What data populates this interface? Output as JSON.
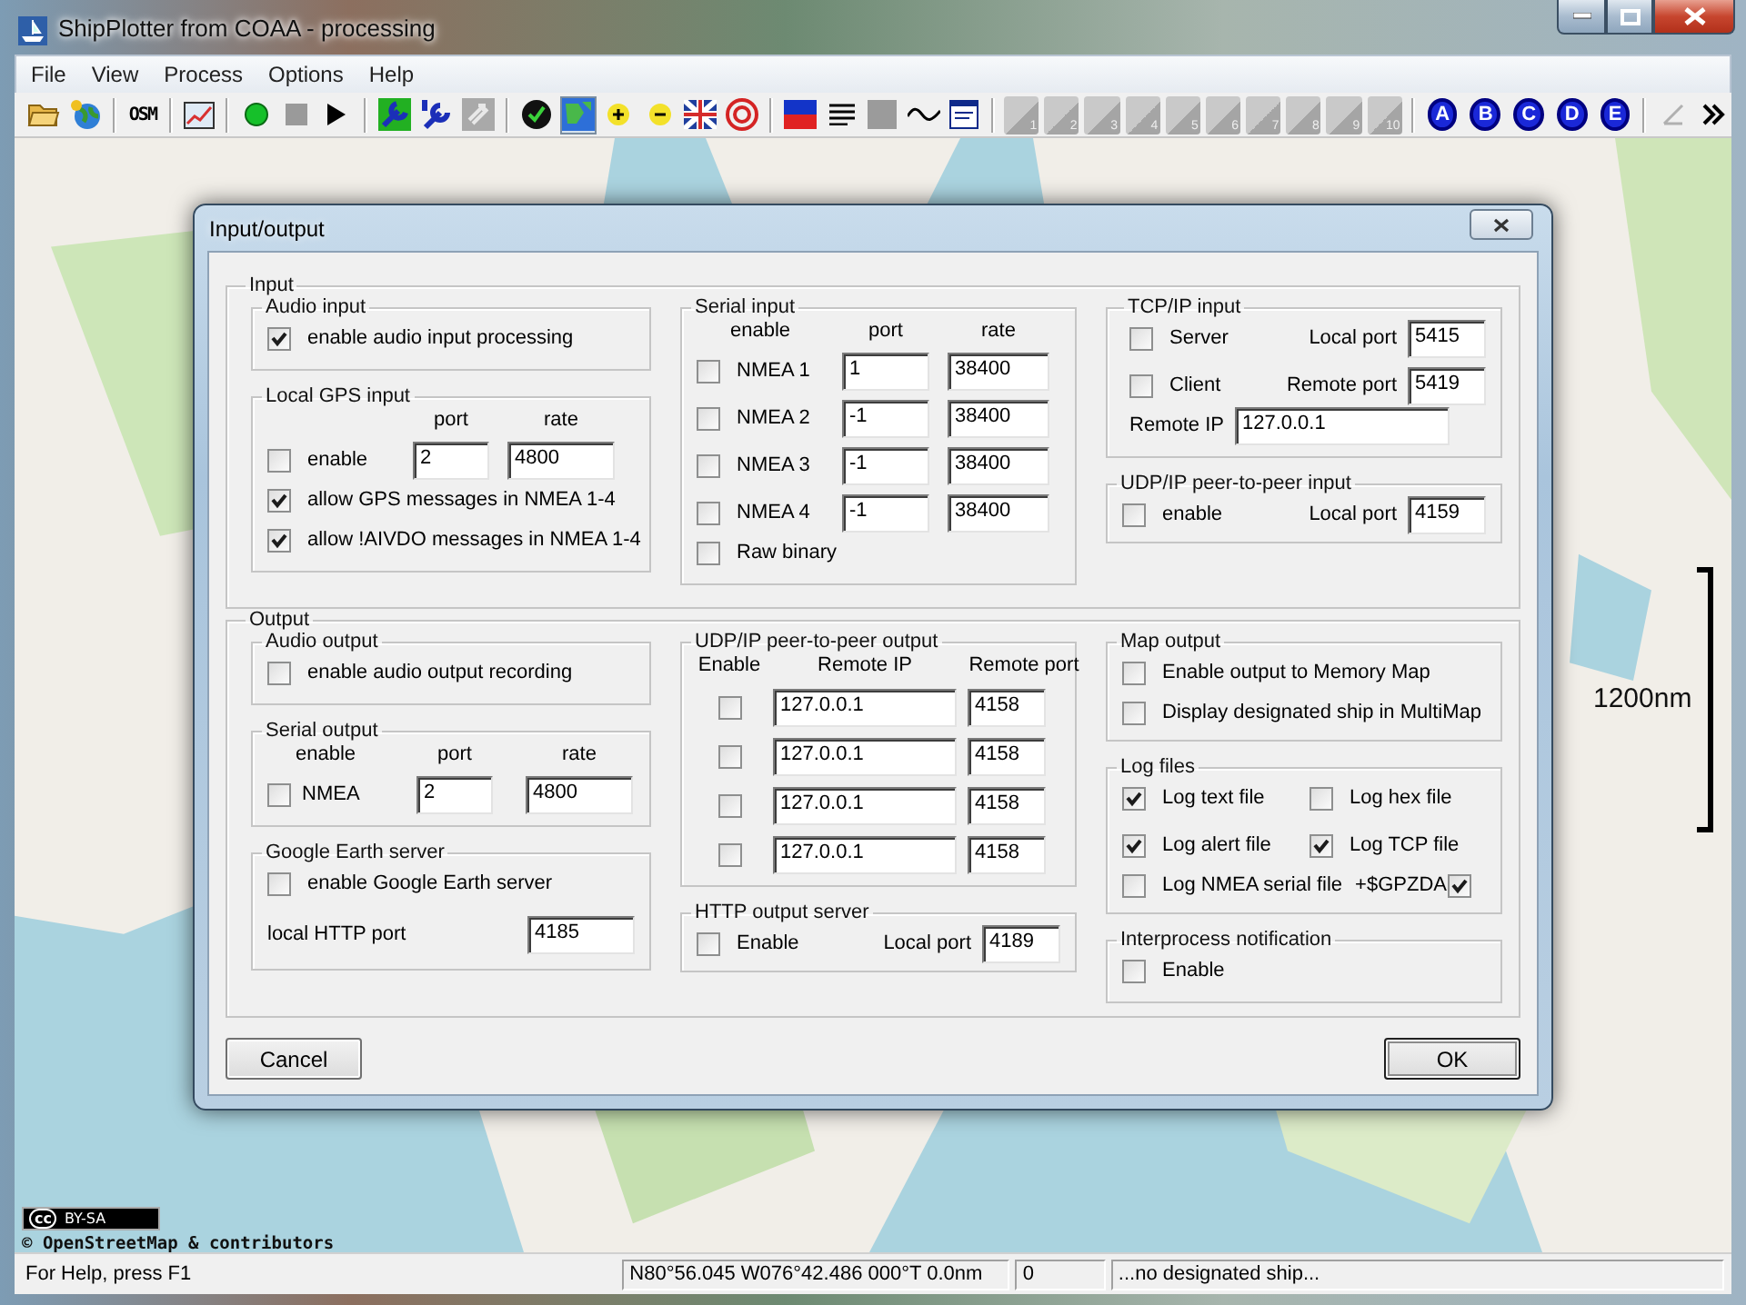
{
  "window": {
    "title": "ShipPlotter from COAA - processing"
  },
  "menu": [
    "File",
    "View",
    "Process",
    "Options",
    "Help"
  ],
  "toolbar": {
    "osm": "OSM",
    "map_view": {
      "selected": true
    },
    "slots": [
      "1",
      "2",
      "3",
      "4",
      "5",
      "6",
      "7",
      "8",
      "9",
      "10"
    ],
    "filters": [
      "A",
      "B",
      "C",
      "D",
      "E"
    ]
  },
  "map": {
    "scale": "1200nm",
    "license": "BY-SA",
    "cc": "cc",
    "attribution": "© OpenStreetMap & contributors"
  },
  "dialog": {
    "title": "Input/output",
    "input": {
      "label": "Input",
      "audio": {
        "label": "Audio input",
        "enable": {
          "label": "enable audio input processing",
          "checked": true
        }
      },
      "gps": {
        "label": "Local GPS input",
        "headings": [
          "port",
          "rate"
        ],
        "enable": {
          "label": "enable",
          "checked": false
        },
        "port": "2",
        "rate": "4800",
        "options": [
          {
            "label": "allow GPS messages in NMEA 1-4",
            "checked": true
          },
          {
            "label": "allow !AIVDO messages in NMEA 1-4",
            "checked": true
          }
        ]
      },
      "serial": {
        "label": "Serial input",
        "headings": [
          "enable",
          "port",
          "rate"
        ],
        "rows": [
          {
            "label": "NMEA 1",
            "checked": false,
            "port": "1",
            "rate": "38400"
          },
          {
            "label": "NMEA 2",
            "checked": false,
            "port": "-1",
            "rate": "38400"
          },
          {
            "label": "NMEA 3",
            "checked": false,
            "port": "-1",
            "rate": "38400"
          },
          {
            "label": "NMEA 4",
            "checked": false,
            "port": "-1",
            "rate": "38400"
          }
        ],
        "raw": {
          "label": "Raw binary",
          "checked": false
        }
      },
      "tcp": {
        "label": "TCP/IP input",
        "server": {
          "label": "Server",
          "checked": false
        },
        "local_port_label": "Local port",
        "local_port": "5415",
        "client": {
          "label": "Client",
          "checked": false
        },
        "remote_port_label": "Remote port",
        "remote_port": "5419",
        "remote_ip_label": "Remote IP",
        "remote_ip": "127.0.0.1"
      },
      "udp": {
        "label": "UDP/IP peer-to-peer input",
        "enable": {
          "label": "enable",
          "checked": false
        },
        "local_port_label": "Local port",
        "local_port": "4159"
      }
    },
    "output": {
      "label": "Output",
      "audio": {
        "label": "Audio output",
        "enable": {
          "label": "enable audio output recording",
          "checked": false
        }
      },
      "serial": {
        "label": "Serial output",
        "headings": [
          "enable",
          "port",
          "rate"
        ],
        "enable": {
          "label": "NMEA",
          "checked": false
        },
        "port": "2",
        "rate": "4800"
      },
      "google": {
        "label": "Google Earth server",
        "enable": {
          "label": "enable Google Earth server",
          "checked": false
        },
        "port_label": "local HTTP port",
        "port": "4185"
      },
      "udp": {
        "label": "UDP/IP peer-to-peer output",
        "headings": [
          "Enable",
          "Remote IP",
          "Remote port"
        ],
        "rows": [
          {
            "checked": false,
            "ip": "127.0.0.1",
            "port": "4158"
          },
          {
            "checked": false,
            "ip": "127.0.0.1",
            "port": "4158"
          },
          {
            "checked": false,
            "ip": "127.0.0.1",
            "port": "4158"
          },
          {
            "checked": false,
            "ip": "127.0.0.1",
            "port": "4158"
          }
        ]
      },
      "http": {
        "label": "HTTP output server",
        "enable": {
          "label": "Enable",
          "checked": false
        },
        "port_label": "Local port",
        "port": "4189"
      },
      "map": {
        "label": "Map output",
        "options": [
          {
            "label": "Enable output to Memory Map",
            "checked": false
          },
          {
            "label": "Display designated ship in MultiMap",
            "checked": false
          }
        ]
      },
      "log": {
        "label": "Log files",
        "options": [
          {
            "label": "Log text file",
            "checked": true
          },
          {
            "label": "Log hex file",
            "checked": false
          },
          {
            "label": "Log alert file",
            "checked": true
          },
          {
            "label": "Log TCP file",
            "checked": true
          }
        ],
        "nmea": {
          "label": "Log NMEA serial file",
          "checked": false
        },
        "gpzda": {
          "label": "+$GPZDA",
          "checked": true
        }
      },
      "ipc": {
        "label": "Interprocess notification",
        "enable": {
          "label": "Enable",
          "checked": false
        }
      }
    },
    "buttons": [
      {
        "label": "Cancel",
        "default": false
      },
      {
        "label": "OK",
        "default": true
      }
    ]
  },
  "status_bar": [
    "For Help, press F1",
    "N80°56.045 W076°42.486 000°T 0.0nm",
    "0",
    "...no designated ship..."
  ]
}
